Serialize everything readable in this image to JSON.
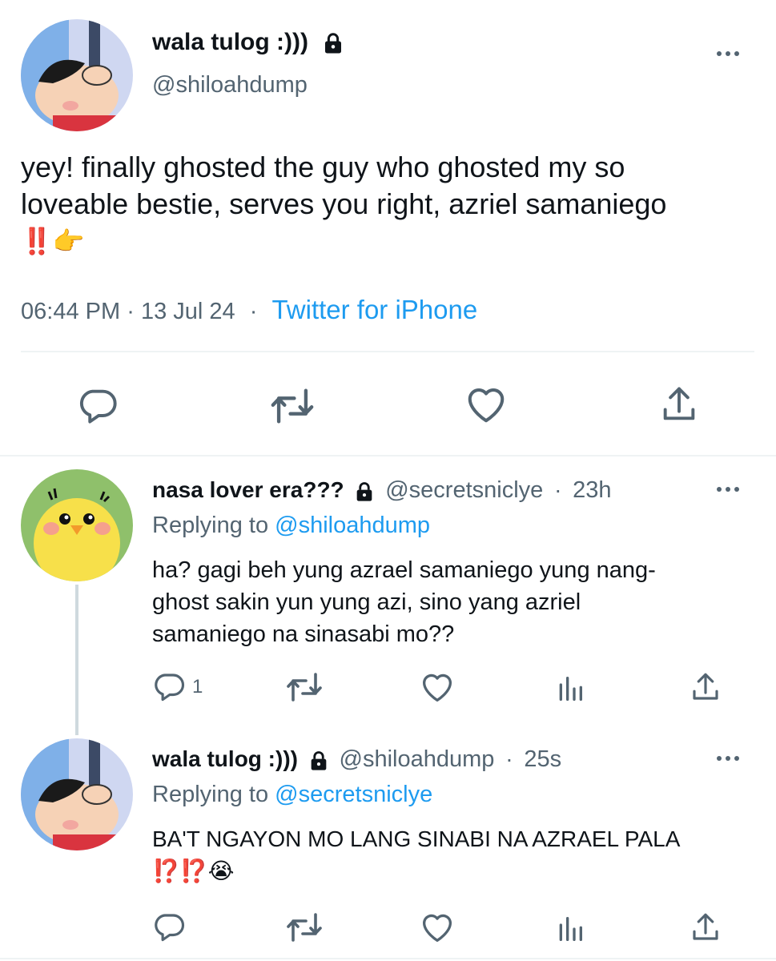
{
  "main_tweet": {
    "display_name": "wala tulog :)))",
    "handle": "@shiloahdump",
    "text_line1": "yey! finally ghosted the guy who ghosted my so",
    "text_line2": "loveable bestie, serves you right, azriel samaniego",
    "text_emojis": "‼️👉",
    "time": "06:44 PM",
    "date": "13 Jul 24",
    "sep": "·",
    "source": "Twitter for iPhone"
  },
  "reply1": {
    "display_name": "nasa lover era???",
    "handle": "@secretsniclye",
    "sep": "·",
    "age": "23h",
    "replying_prefix": "Replying to",
    "replying_to": "@shiloahdump",
    "line1": "ha? gagi beh yung azrael samaniego yung nang-",
    "line2": "ghost sakin yun yung azi, sino yang azriel",
    "line3": "samaniego na sinasabi mo??",
    "reply_count": "1"
  },
  "reply2": {
    "display_name": "wala tulog :)))",
    "handle": "@shiloahdump",
    "sep": "·",
    "age": "25s",
    "replying_prefix": "Replying to",
    "replying_to": "@secretsniclye",
    "line1": "BA'T NGAYON MO LANG SINABI NA AZRAEL PALA",
    "line2": "⁉️⁉️😭"
  },
  "colors": {
    "accent": "#1d9bf0",
    "text": "#0f1419",
    "muted": "#536471",
    "divider": "#eff3f4"
  },
  "icons": [
    "lock-icon",
    "more-icon",
    "reply-icon",
    "retweet-icon",
    "like-icon",
    "share-icon",
    "analytics-icon"
  ]
}
